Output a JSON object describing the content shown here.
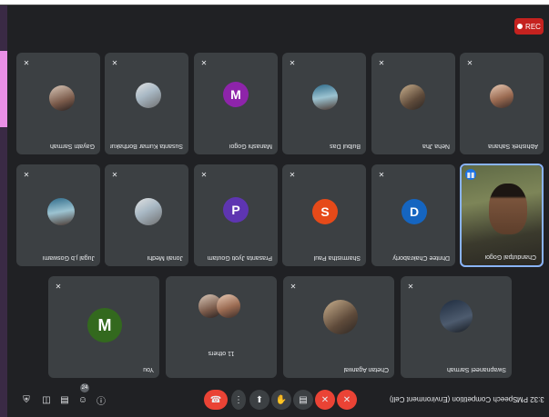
{
  "recording": {
    "label": "REC"
  },
  "participants": [
    {
      "name": "Abhishek Saharia"
    },
    {
      "name": "Neha Jha"
    },
    {
      "name": "Bulbul Das"
    },
    {
      "name": "Manashi Gogoi",
      "initial": "M"
    },
    {
      "name": "Susanta Kumar Borthakur"
    },
    {
      "name": "Gayatri Sarmah"
    },
    {
      "name": "Chandutpal Gogoi"
    },
    {
      "name": "Dhritee Chakraborty",
      "initial": "D"
    },
    {
      "name": "Sharmistha Paul",
      "initial": "S"
    },
    {
      "name": "Prasanta Jyoti Goutam",
      "initial": "P"
    },
    {
      "name": "Jonali Medhi"
    },
    {
      "name": "Jugal j.b Goswami"
    },
    {
      "name": "Swapnaneel Sarmah"
    },
    {
      "name": "Chetan Agarwal"
    },
    {
      "name": "11 others"
    },
    {
      "name": "You",
      "initial": "M"
    }
  ],
  "bottom_bar": {
    "time": "3:32 PM",
    "meeting_title": "Speech Competition (Environment Cell)",
    "people_count": "24"
  },
  "colors": {
    "stage_bg": "#202124",
    "tile_bg": "#3c4043",
    "active_border": "#8ab4f8",
    "danger": "#ea4335",
    "avatar_manashi": "#8e24aa",
    "avatar_dhritee": "#1565c0",
    "avatar_sharmistha": "#e64a19",
    "avatar_prasanta": "#5e35b1",
    "avatar_you": "#33691e"
  }
}
